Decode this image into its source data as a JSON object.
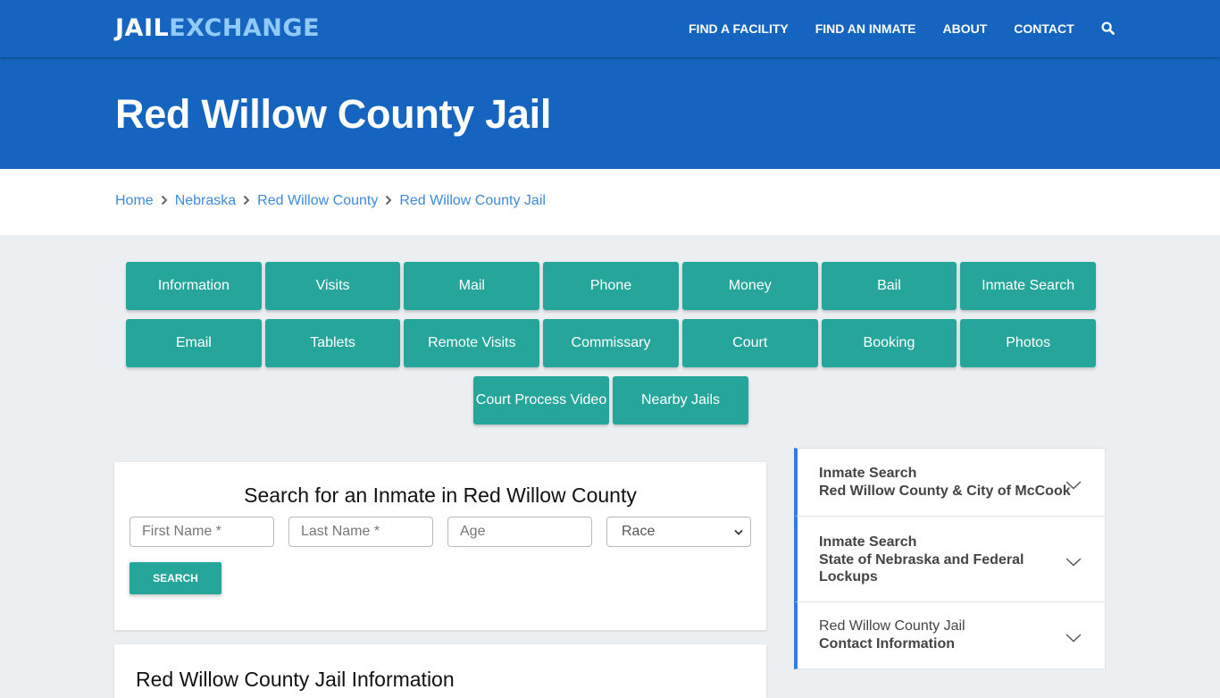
{
  "header": {
    "logo_part1": "JAIL",
    "logo_part2": "EXCHANGE",
    "nav": [
      "FIND A FACILITY",
      "FIND AN INMATE",
      "ABOUT",
      "CONTACT"
    ],
    "search_icon": "search-icon"
  },
  "hero": {
    "title": "Red Willow County Jail"
  },
  "breadcrumb": [
    "Home",
    "Nebraska",
    "Red Willow County",
    "Red Willow County Jail"
  ],
  "tiles": {
    "row1": [
      "Information",
      "Visits",
      "Mail",
      "Phone",
      "Money",
      "Bail",
      "Inmate Search"
    ],
    "row2": [
      "Email",
      "Tablets",
      "Remote Visits",
      "Commissary",
      "Court",
      "Booking",
      "Photos"
    ],
    "row3": [
      "Court Process Video",
      "Nearby Jails"
    ]
  },
  "search": {
    "title": "Search for an Inmate in Red Willow County",
    "first_name_placeholder": "First Name *",
    "last_name_placeholder": "Last Name *",
    "age_placeholder": "Age",
    "race_selected": "Race",
    "button": "SEARCH"
  },
  "info": {
    "title": "Red Willow County Jail Information"
  },
  "sidebar": [
    {
      "line1": "Inmate Search",
      "line2": "Red Willow County & City of McCook"
    },
    {
      "line1": "Inmate Search",
      "line2": "State of Nebraska and Federal Lockups"
    },
    {
      "line1": "Red Willow County Jail",
      "line2": "Contact Information"
    }
  ],
  "colors": {
    "brand_blue": "#1565c0",
    "logo_light": "#90caf9",
    "teal": "#26a69a",
    "link": "#3d8bdc",
    "accent_border": "#2f80d8",
    "page_bg": "#eceff1"
  }
}
